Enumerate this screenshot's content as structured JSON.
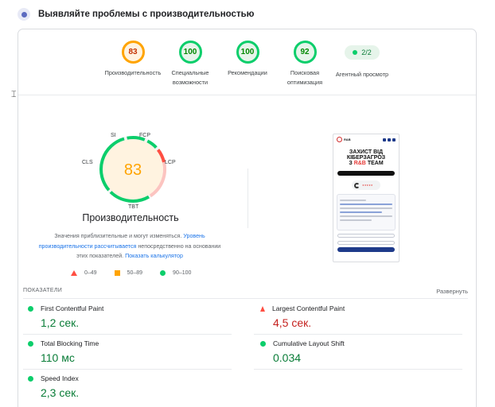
{
  "header": {
    "title": "Выявляйте проблемы с производительностью"
  },
  "scores": [
    {
      "value": "83",
      "label": "Производительность",
      "color": "#ffa400"
    },
    {
      "value": "100",
      "label": "Специальные возможности",
      "color": "#0cce6b"
    },
    {
      "value": "100",
      "label": "Рекомендации",
      "color": "#0cce6b"
    },
    {
      "value": "92",
      "label": "Поисковая оптимизация",
      "color": "#0cce6b"
    }
  ],
  "agent": {
    "value": "2/2",
    "label": "Агентный просмотр"
  },
  "performance": {
    "score": "83",
    "title": "Производительность",
    "tags": {
      "si": "SI",
      "fcp": "FCP",
      "lcp": "LCP",
      "tbt": "TBT",
      "cls": "CLS"
    },
    "note_prefix": "Значения приблизительные и могут изменяться.",
    "note_link1": "Уровень производительности рассчитывается",
    "note_middle": "непосредственно на основании этих показателей.",
    "note_link2": "Показать калькулятор"
  },
  "legend": [
    {
      "range": "0–49",
      "color": "#ff4e42"
    },
    {
      "range": "50–89",
      "color": "#ffa400"
    },
    {
      "range": "90–100",
      "color": "#0cce6b"
    }
  ],
  "preview": {
    "headline_1": "ЗАХИСТ ВІД",
    "headline_2": "КІБЕРЗАГРОЗ",
    "headline_3a": "З",
    "headline_3b": "R&B",
    "headline_3c": "TEAM"
  },
  "metrics_section": {
    "heading": "ПОКАЗАТЕЛИ",
    "expand": "Развернуть",
    "items": [
      {
        "name": "First Contentful Paint",
        "value": "1,2 сек.",
        "status": "good"
      },
      {
        "name": "Largest Contentful Paint",
        "value": "4,5 сек.",
        "status": "poor"
      },
      {
        "name": "Total Blocking Time",
        "value": "110 мс",
        "status": "good"
      },
      {
        "name": "Cumulative Layout Shift",
        "value": "0.034",
        "status": "good"
      },
      {
        "name": "Speed Index",
        "value": "2,3 сек.",
        "status": "good"
      }
    ]
  }
}
